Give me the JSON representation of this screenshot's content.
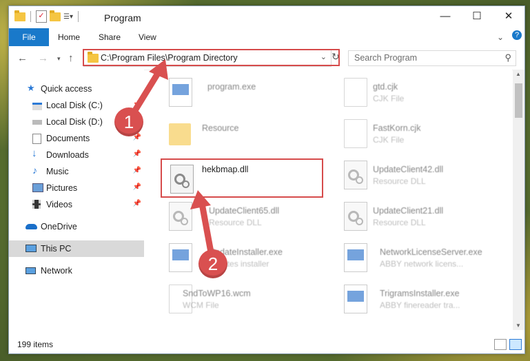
{
  "window": {
    "title": "Program"
  },
  "ribbon": {
    "tabs": [
      "File",
      "Home",
      "Share",
      "View"
    ]
  },
  "address": {
    "path": "C:\\Program Files\\Program Directory"
  },
  "search": {
    "placeholder": "Search Program"
  },
  "sidebar": {
    "items": [
      {
        "label": "Quick access",
        "icon": "star-icon"
      },
      {
        "label": "Local Disk (C:)",
        "icon": "drive-icon"
      },
      {
        "label": "Local Disk (D:)",
        "icon": "drive-icon"
      },
      {
        "label": "Documents",
        "icon": "documents-icon"
      },
      {
        "label": "Downloads",
        "icon": "download-icon"
      },
      {
        "label": "Music",
        "icon": "music-icon"
      },
      {
        "label": "Pictures",
        "icon": "pictures-icon"
      },
      {
        "label": "Videos",
        "icon": "videos-icon"
      },
      {
        "label": "OneDrive",
        "icon": "cloud-icon"
      },
      {
        "label": "This PC",
        "icon": "computer-icon"
      },
      {
        "label": "Network",
        "icon": "network-icon"
      }
    ]
  },
  "files": [
    {
      "name": "program.exe",
      "sub": ""
    },
    {
      "name": "gtd.cjk",
      "sub": "CJK File"
    },
    {
      "name": "Resource",
      "sub": ""
    },
    {
      "name": "FastKorn.cjk",
      "sub": "CJK File"
    },
    {
      "name": "hekbmap.dll",
      "sub": ""
    },
    {
      "name": "UpdateClient42.dll",
      "sub": "Resource DLL"
    },
    {
      "name": "UpdateClient65.dll",
      "sub": "Resource DLL"
    },
    {
      "name": "UpdateClient21.dll",
      "sub": "Resource DLL"
    },
    {
      "name": "UpdateInstaller.exe",
      "sub": "updates installer"
    },
    {
      "name": "NetworkLicenseServer.exe",
      "sub": "ABBY network licens..."
    },
    {
      "name": "SndToWP16.wcm",
      "sub": "WCM File"
    },
    {
      "name": "TrigramsInstaller.exe",
      "sub": "ABBY finereader tra..."
    }
  ],
  "status": {
    "items_count": "199 items"
  },
  "badges": {
    "one": "1",
    "two": "2"
  },
  "colors": {
    "accent": "#1979ca",
    "highlight": "#d64b4b"
  }
}
